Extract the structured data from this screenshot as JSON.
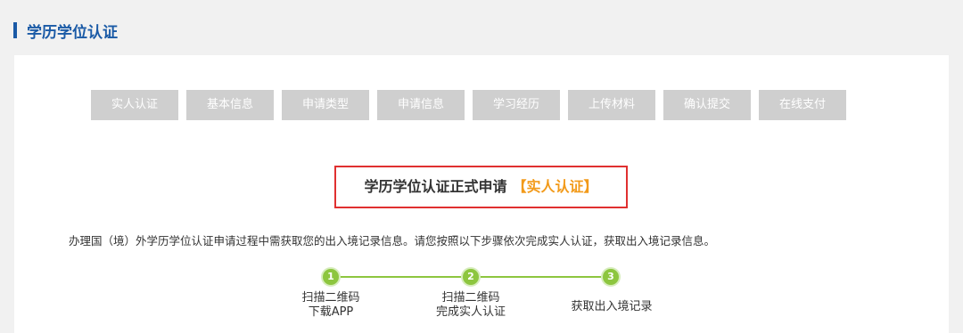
{
  "header": {
    "title": "学历学位认证"
  },
  "colors": {
    "accent": "#1a5aa6",
    "step_bg": "#cfcfcf",
    "highlight_border": "#e03030",
    "highlight_text": "#f29a1a",
    "progress": "#8dc63f"
  },
  "steps": [
    {
      "label": "实人认证"
    },
    {
      "label": "基本信息"
    },
    {
      "label": "申请类型"
    },
    {
      "label": "申请信息"
    },
    {
      "label": "学习经历"
    },
    {
      "label": "上传材料"
    },
    {
      "label": "确认提交"
    },
    {
      "label": "在线支付"
    }
  ],
  "title": {
    "main": "学历学位认证正式申请",
    "sub": "【实人认证】"
  },
  "intro": "办理国（境）外学历学位认证申请过程中需获取您的出入境记录信息。请您按照以下步骤依次完成实人认证，获取出入境记录信息。",
  "progress": [
    {
      "num": "1",
      "line1": "扫描二维码",
      "line2": "下载APP"
    },
    {
      "num": "2",
      "line1": "扫描二维码",
      "line2": "完成实人认证"
    },
    {
      "num": "3",
      "line1": "获取出入境记录",
      "line2": ""
    }
  ]
}
